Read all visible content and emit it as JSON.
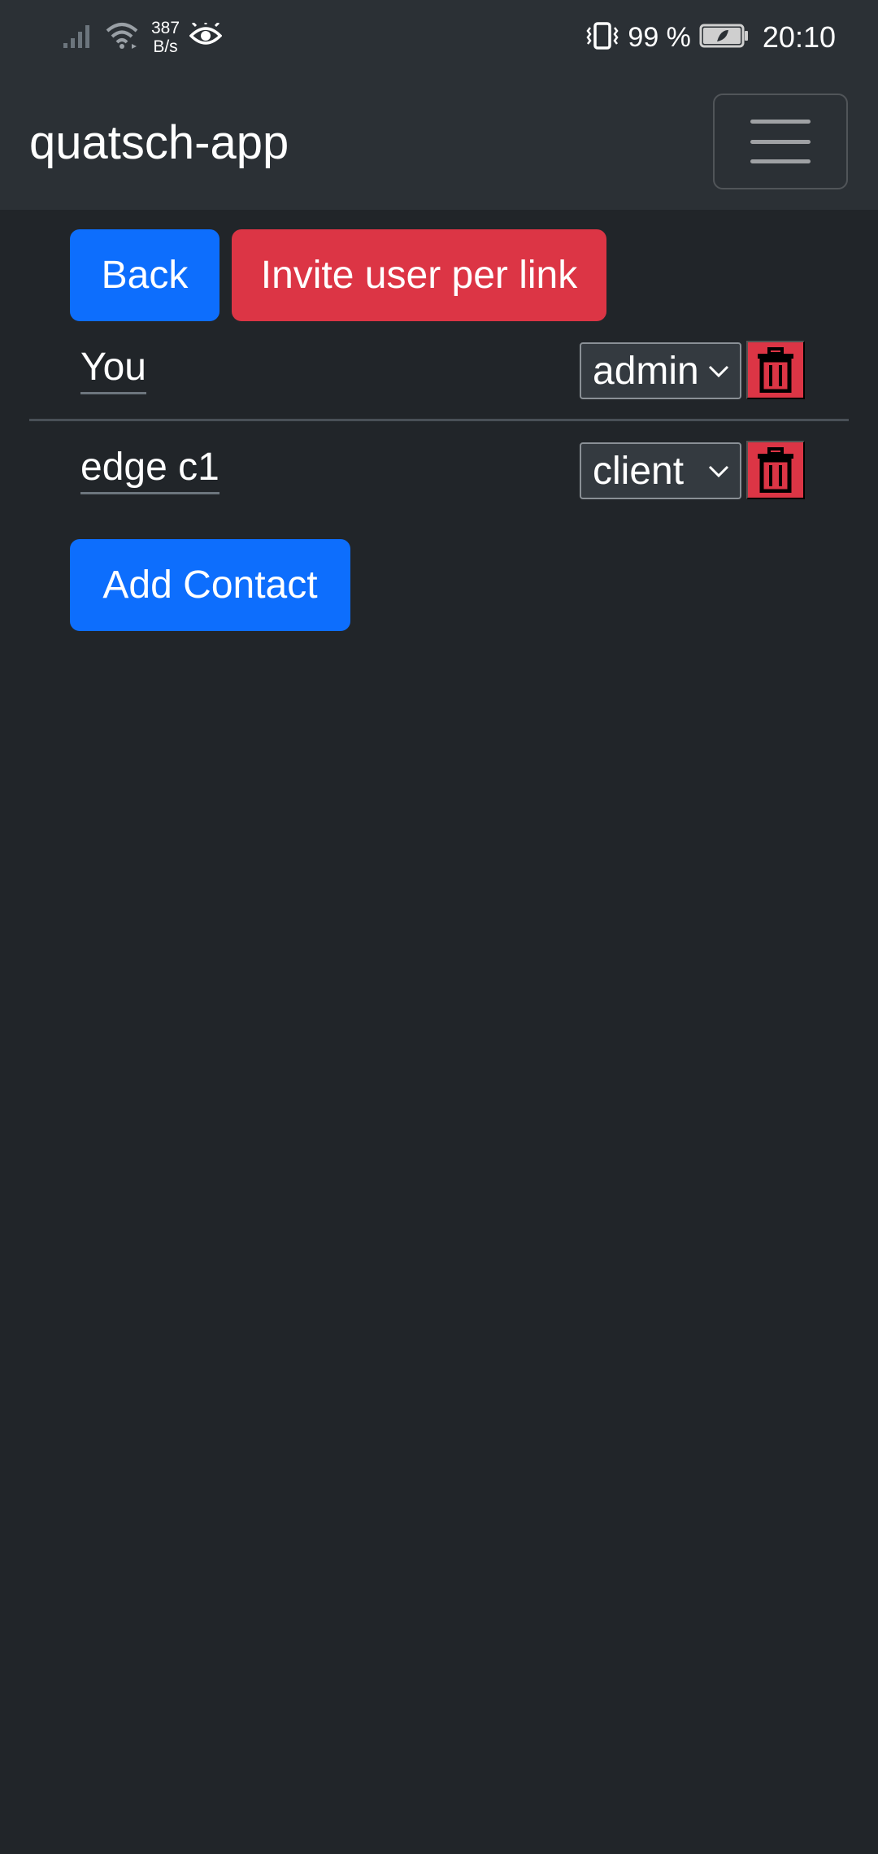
{
  "status_bar": {
    "net_speed_value": "387",
    "net_speed_unit": "B/s",
    "battery_percent": "99 %",
    "time": "20:10",
    "icons": [
      "signal-icon",
      "wifi-icon",
      "eye-icon",
      "vibrate-icon",
      "battery-icon"
    ]
  },
  "navbar": {
    "brand": "quatsch-app",
    "menu_icon": "hamburger-menu-icon"
  },
  "actions": {
    "back_label": "Back",
    "invite_label": "Invite user per link",
    "add_contact_label": "Add Contact"
  },
  "users": [
    {
      "name": "You",
      "role": "admin",
      "delete_icon": "trash-icon"
    },
    {
      "name": "edge c1",
      "role": "client",
      "delete_icon": "trash-icon"
    }
  ],
  "colors": {
    "background": "#212529",
    "navbar": "#2b3035",
    "primary": "#0d6efd",
    "danger": "#dc3545"
  }
}
